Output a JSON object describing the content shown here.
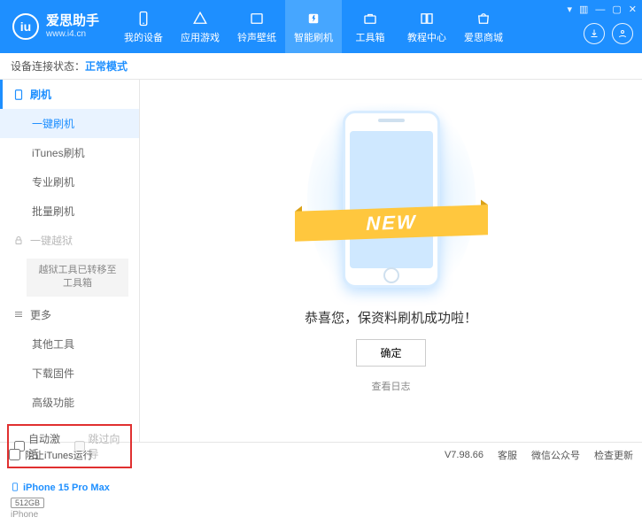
{
  "header": {
    "title": "爱思助手",
    "url": "www.i4.cn",
    "nav": [
      "我的设备",
      "应用游戏",
      "铃声壁纸",
      "智能刷机",
      "工具箱",
      "教程中心",
      "爱思商城"
    ],
    "winctrl": {
      "menu": "▾",
      "skin": "▥",
      "min": "—",
      "max": "▢",
      "close": "✕"
    }
  },
  "status": {
    "label": "设备连接状态：",
    "value": "正常模式"
  },
  "sidebar": {
    "sections": [
      {
        "label": "刷机",
        "items": [
          "一键刷机",
          "iTunes刷机",
          "专业刷机",
          "批量刷机"
        ]
      },
      {
        "label": "一键越狱",
        "note": "越狱工具已转移至\n工具箱"
      },
      {
        "label": "更多",
        "items": [
          "其他工具",
          "下载固件",
          "高级功能"
        ]
      }
    ],
    "checkboxes": {
      "auto": "自动激活",
      "skip": "跳过向导"
    },
    "device": {
      "name": "iPhone 15 Pro Max",
      "storage": "512GB",
      "type": "iPhone"
    }
  },
  "main": {
    "badge": "NEW",
    "message": "恭喜您，保资料刷机成功啦！",
    "ok": "确定",
    "log": "查看日志"
  },
  "footer": {
    "block": "阻止iTunes运行",
    "version": "V7.98.66",
    "links": [
      "客服",
      "微信公众号",
      "检查更新"
    ]
  }
}
